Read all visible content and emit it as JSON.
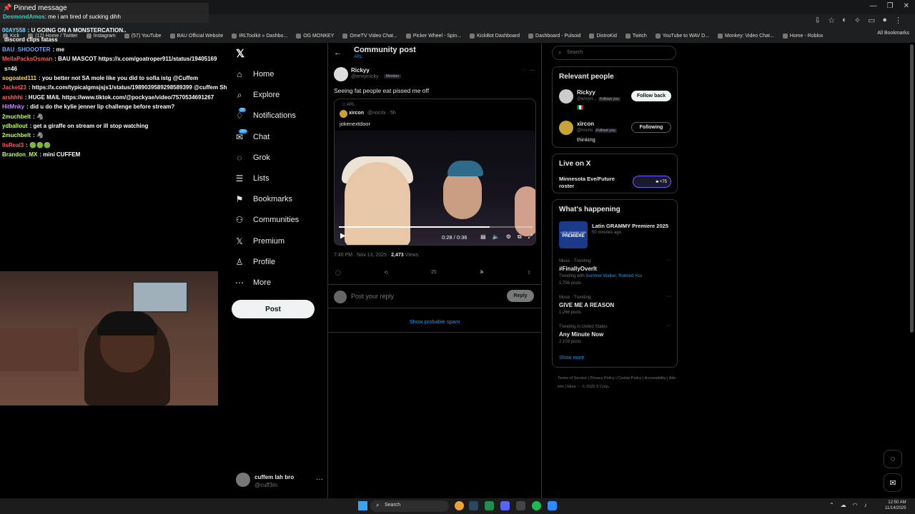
{
  "browser": {
    "tabstrip_text": "",
    "window_controls": [
      "—",
      "❐",
      "✕"
    ],
    "bookmarks": [
      "Kick",
      "(12) Home / Twitter",
      "Instagram",
      "(57) YouTube",
      "BAU Official Website",
      "IRLToolkit » Dashbo...",
      "OG MONKEY",
      "OmeTV Video Chat...",
      "Picker Wheel - Spin...",
      "KickBot Dashboard",
      "Dashboard - Pulsoid",
      "DistroKid",
      "Twitch",
      "YouTube to WAV D...",
      "Monkey: Video Chat...",
      "Home - Roblox"
    ],
    "all_bookmarks": "All Bookmarks"
  },
  "stream_chat": {
    "pinned_title": "Pinned message",
    "pinned_user": "DesmondAmos",
    "pinned_text": ": me i am tired of sucking dihh",
    "messages": [
      {
        "user": "00AY558",
        "text": ": U GOING ON A MONSTERCATION..",
        "color": "#7cd3ff"
      },
      {
        "user": "",
        "text": "discord clips fatass",
        "color": "#ff6b6b"
      },
      {
        "user": "BAU_SHOOOTER",
        "text": ": me",
        "color": "#6aa8ff"
      },
      {
        "user": "MellaPacksOsman",
        "text": ": BAU MASCOT https://x.com/goatroper911/status/19405169",
        "color": "#ff5a5a"
      },
      {
        "user": "",
        "text": "s=46",
        "color": "#ffffff"
      },
      {
        "user": "sogoated111",
        "text": ": you better not SA mole like you did to sofia istg @Cuffem",
        "color": "#ffd86b"
      },
      {
        "user": "Jacket23",
        "text": ": https://x.com/typicalgmsjsjs1/status/1989039589298589399 @cuffem Sh",
        "color": "#ff5a5a"
      },
      {
        "user": "arshhhi",
        "text": ": HUGE MAIL https://www.tiktok.com/@pockyae/video/7570534691267",
        "color": "#ff6b6b"
      },
      {
        "user": "HitMnky",
        "text": ": did u do the kylie jenner lip challenge before stream?",
        "color": "#c38bff"
      },
      {
        "user": "2muchbelt",
        "text": ": 🦓",
        "color": "#b7ff6b"
      },
      {
        "user": "ydballout",
        "text": ": get a giraffe on stream or ill stop watching",
        "color": "#b7ff6b"
      },
      {
        "user": "2muchbelt",
        "text": ": 🦓",
        "color": "#b7ff6b"
      },
      {
        "user": "lisReal3",
        "text": ": 🟢🟢🟢",
        "color": "#ff5a5a"
      },
      {
        "user": "Brandon_MX",
        "text": ": mini CUFFEM",
        "color": "#b7ff6b"
      }
    ]
  },
  "x_nav": {
    "logo": "𝕏",
    "items": [
      {
        "label": "Home",
        "icon": "home-icon",
        "glyph": "⌂"
      },
      {
        "label": "Explore",
        "icon": "search-icon",
        "glyph": "⌕"
      },
      {
        "label": "Notifications",
        "icon": "bell-icon",
        "glyph": "♢",
        "badge": "20"
      },
      {
        "label": "Chat",
        "icon": "chat-icon",
        "glyph": "✉",
        "badge": "20+"
      },
      {
        "label": "Grok",
        "icon": "grok-icon",
        "glyph": "◌"
      },
      {
        "label": "Lists",
        "icon": "list-icon",
        "glyph": "☰"
      },
      {
        "label": "Bookmarks",
        "icon": "bookmark-icon",
        "glyph": "⚑"
      },
      {
        "label": "Communities",
        "icon": "communities-icon",
        "glyph": "⚇"
      },
      {
        "label": "Premium",
        "icon": "premium-icon",
        "glyph": "𝕏"
      },
      {
        "label": "Profile",
        "icon": "profile-icon",
        "glyph": "♙"
      },
      {
        "label": "More",
        "icon": "more-icon",
        "glyph": "⋯"
      }
    ],
    "post_button": "Post",
    "account_name": "cuffem lah bro",
    "account_handle": "@cuff3m",
    "account_more": "···"
  },
  "main": {
    "header_title": "Community post",
    "header_sub": "ARL",
    "author_name": "Rickyy",
    "author_handle": "@envyrricky ·",
    "author_role": "Member",
    "post_text": "Seeing fat people eat pissed me off",
    "quote": {
      "community": "ARL",
      "name": "xircon",
      "handle": "@nocrlx · 5h",
      "text": "jokenextdoor",
      "video_time": "0:28 / 0:36",
      "progress": 0.78
    },
    "meta_time": "7:40 PM · Nov 13, 2025 ·",
    "meta_views": "2,473",
    "meta_views_label": "Views",
    "likes": "25",
    "bookmarks": "2",
    "reply_placeholder": "Post your reply",
    "reply_button": "Reply",
    "show_spam": "Show probable spam"
  },
  "right": {
    "search_placeholder": "Search",
    "relevant_title": "Relevant people",
    "people": [
      {
        "name": "Rickyy",
        "handle": "@envyrl...",
        "follows_you": "Follows you",
        "bio": "🇮🇹",
        "button": "Follow back"
      },
      {
        "name": "xircon",
        "handle": "@nocrlx",
        "follows_you": "Follows you",
        "bio": "thinking",
        "button": "Following"
      }
    ],
    "live_title": "Live on X",
    "live_name": "Minnesota Eve/Future roster",
    "live_count": "+75",
    "happening_title": "What's happening",
    "event_name": "Latin GRAMMY Premiere 2025",
    "event_time": "50 minutes ago",
    "event_thumb_text": "PREMIERE",
    "event_thumb_top": "LATIN GRAMMY 2025",
    "trends": [
      {
        "category": "Music · Trending",
        "name": "#FinallyOverIt",
        "sub_prefix": "Trending with ",
        "sub_links": "Summer Walker, Robbed You",
        "count": "1,756 posts"
      },
      {
        "category": "Music · Trending",
        "name": "GIVE ME A REASON",
        "sub_prefix": "",
        "sub_links": "",
        "count": "1,266 posts"
      },
      {
        "category": "Trending in United States",
        "name": "Any Minute Now",
        "sub_prefix": "",
        "sub_links": "",
        "count": "2,103 posts"
      }
    ],
    "show_more": "Show more",
    "footer": "Terms of Service  |  Privacy Policy  |  Cookie Policy  |  Accessibility  |  Ads info  |  More ···  © 2025 X Corp."
  },
  "taskbar": {
    "search_label": "Search",
    "time": "12:50 AM",
    "date": "11/14/2025"
  },
  "colors": {
    "accent": "#1d9bf0",
    "background": "#000000",
    "border": "#2f3336",
    "muted": "#71767b"
  }
}
